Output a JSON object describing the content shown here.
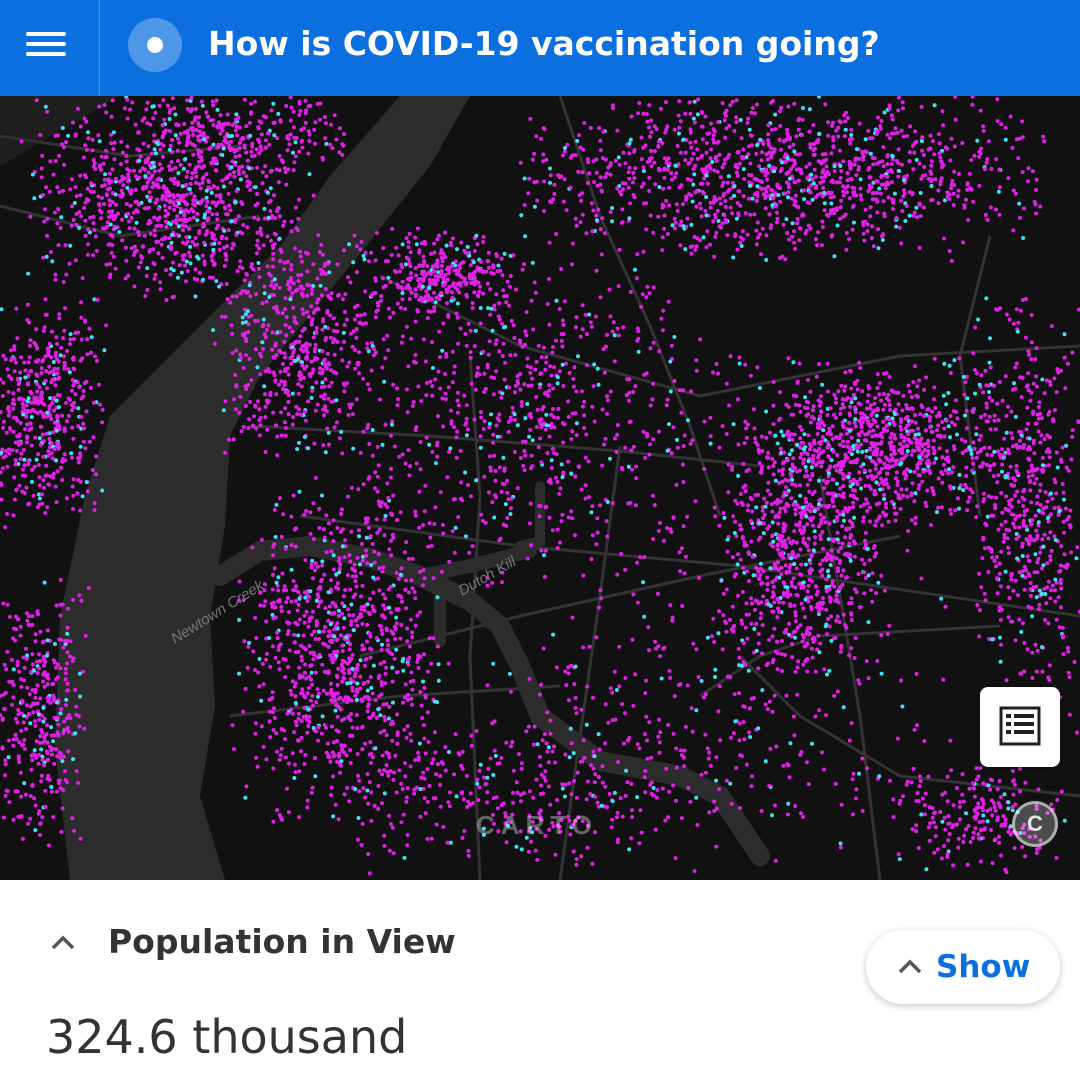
{
  "header": {
    "title": "How is COVID-19 vaccination going?",
    "menu_icon": "hamburger-menu-icon",
    "logo_icon": "radio-dot-logo-icon"
  },
  "map": {
    "labels": {
      "creek": "Newtown Creek",
      "kill": "Dutch Kill"
    },
    "attribution": "CARTO",
    "copyright_symbol": "C",
    "legend_icon": "list-icon",
    "colors": {
      "background": "#111111",
      "water": "#2c2c2c",
      "roads": "#333333",
      "vaccinated_dot": "#e020e6",
      "unvaccinated_dot": "#3fe2f0"
    }
  },
  "panel": {
    "title": "Population in View",
    "value": "324.6 thousand",
    "show_label": "Show",
    "collapse_icon": "chevron-up-icon"
  },
  "colors": {
    "accent": "#0b6fe0"
  }
}
